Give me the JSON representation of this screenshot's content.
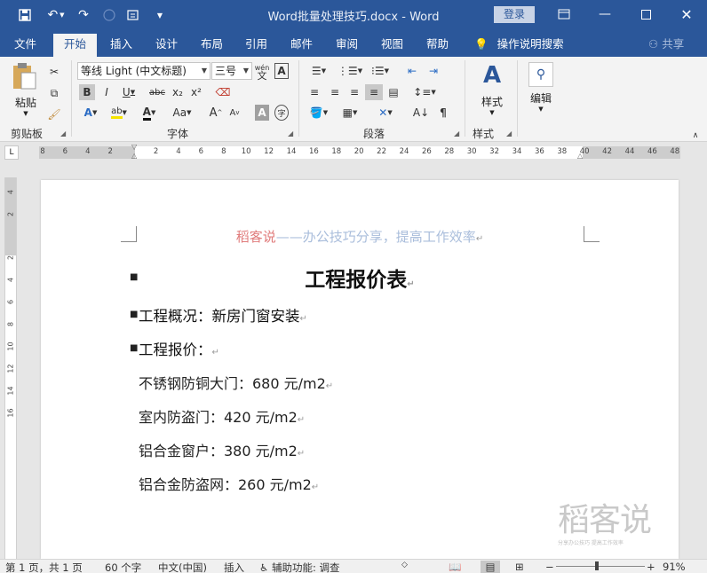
{
  "titlebar": {
    "doc_title": "Word批量处理技巧.docx  -  Word",
    "login": "登录"
  },
  "tabs": [
    "文件",
    "开始",
    "插入",
    "设计",
    "布局",
    "引用",
    "邮件",
    "审阅",
    "视图",
    "帮助"
  ],
  "active_tab": "开始",
  "tell_me": "操作说明搜索",
  "share": "共享",
  "ribbon": {
    "clipboard": {
      "paste": "粘贴",
      "label": "剪贴板"
    },
    "font": {
      "name": "等线 Light (中文标题)",
      "size": "三号",
      "label": "字体",
      "wen_top": "wén",
      "wen_char": "文"
    },
    "paragraph": {
      "label": "段落"
    },
    "styles": {
      "button": "样式",
      "label": "样式"
    },
    "editing": {
      "button": "编辑"
    }
  },
  "ruler": {
    "h_ticks": [
      "8",
      "6",
      "4",
      "2",
      "2",
      "4",
      "6",
      "8",
      "10",
      "12",
      "14",
      "16",
      "18",
      "20",
      "22",
      "24",
      "26",
      "28",
      "30",
      "32",
      "34",
      "36",
      "38",
      "40",
      "42",
      "44",
      "46",
      "48"
    ],
    "v_ticks": [
      "4",
      "2",
      "2",
      "4",
      "6",
      "8",
      "10",
      "12",
      "14",
      "16"
    ]
  },
  "document": {
    "header_brand": "稻客说",
    "header_rest": "——办公技巧分享，提高工作效率",
    "heading": "工程报价表",
    "overview_label": "工程概况：",
    "overview_value": "新房门窗安装",
    "quote_label": "工程报价：",
    "items": [
      "不锈钢防铜大门：680 元/m2",
      "室内防盗门：420 元/m2",
      "铝合金窗户：380 元/m2",
      "铝合金防盗网：260 元/m2"
    ],
    "para_mark": "↵",
    "watermark": "稻客说",
    "watermark_sub": "分享办公技巧  提高工作效率"
  },
  "status": {
    "page": "第 1 页，共 1 页",
    "words": "60 个字",
    "language": "中文(中国)",
    "mode": "插入",
    "accessibility": "辅助功能: 调查",
    "zoom": "91%"
  },
  "colors": {
    "title_blue": "#2b579a",
    "header_brand": "#e07b7b",
    "header_text": "#a9bddb"
  }
}
